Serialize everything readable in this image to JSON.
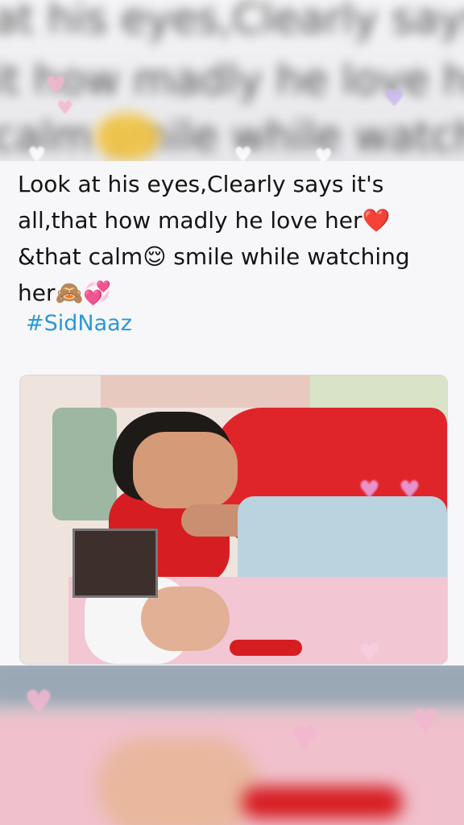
{
  "background_text": {
    "line1": "at his eyes,Clearly says it",
    "line2": "it how madly he love her",
    "line3": "calm smile while watching"
  },
  "tweet": {
    "lines": [
      "Look at his eyes,Clearly says it's",
      "all,that how madly he love her",
      "&that calm",
      " smile while watching",
      "her"
    ],
    "hashtag": "#SidNaaz"
  },
  "emoji": {
    "red_heart": "❤️",
    "relieved_face": "😌",
    "see_no_evil_monkey": "🙈",
    "revolving_hearts": "💞"
  },
  "colors": {
    "hashtag": "#2b98d8",
    "text": "#141414",
    "sweater": "#e0252a",
    "pillow": "#d61d22",
    "hearts": "#f3b7cf"
  },
  "photo": {
    "alt": "man in red sweater lying on a red pillow watching a woman sleeping"
  }
}
